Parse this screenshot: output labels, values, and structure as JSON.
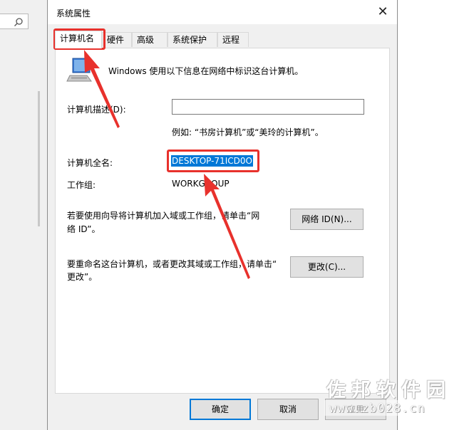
{
  "window": {
    "title": "系统属性"
  },
  "tabs": [
    {
      "label": "计算机名",
      "active": true
    },
    {
      "label": "硬件",
      "active": false
    },
    {
      "label": "高级",
      "active": false
    },
    {
      "label": "系统保护",
      "active": false
    },
    {
      "label": "远程",
      "active": false
    }
  ],
  "panel": {
    "intro": "Windows 使用以下信息在网络中标识这台计算机。",
    "description_label": "计算机描述(D):",
    "description_value": "",
    "example": "例如: “书房计算机”或“美玲的计算机”。",
    "fullname_label": "计算机全名:",
    "fullname_value": "DESKTOP-71ICD0O",
    "workgroup_label": "工作组:",
    "workgroup_value": "WORKGROUP",
    "network_text_1": "若要使用向导将计算机加入域或工作组，请单击“网",
    "network_text_2": "络 ID”。",
    "network_button": "网络 ID(N)...",
    "rename_text_1": "要重命名这台计算机，或者更改其域或工作组，请单击“",
    "rename_text_2": "更改”。",
    "change_button": "更改(C)..."
  },
  "footer": {
    "ok_button": "确定",
    "cancel_button": "取消",
    "apply_button": "应用"
  },
  "watermark": {
    "main": "佐邦软件园",
    "url": "www.zb028.cn"
  },
  "colors": {
    "annotation_red": "#e8312c",
    "selection_blue": "#0078d7",
    "dialog_bg": "#f0f0f0"
  }
}
